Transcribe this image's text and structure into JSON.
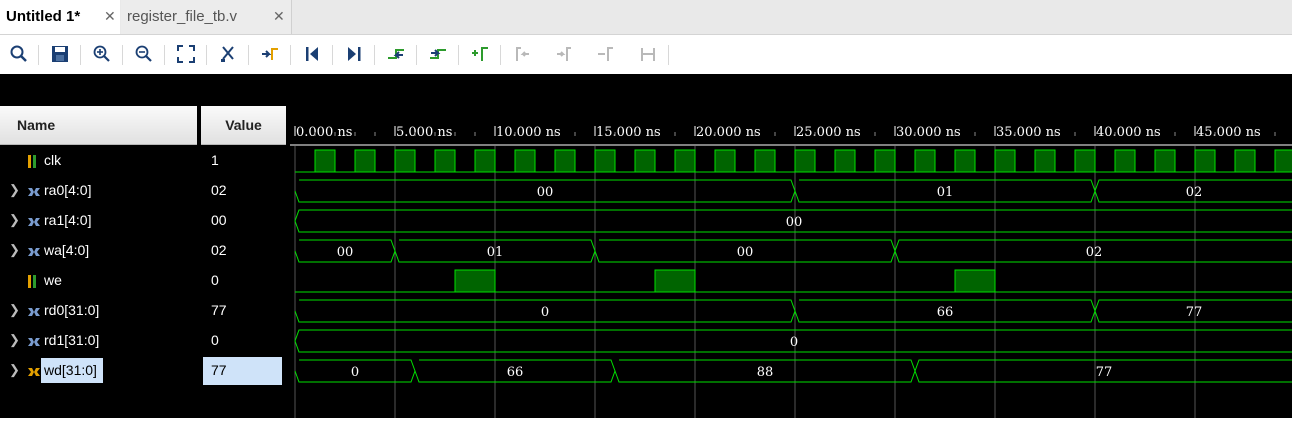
{
  "tabs": [
    {
      "label": "Untitled 1*",
      "active": true
    },
    {
      "label": "register_file_tb.v",
      "active": false
    }
  ],
  "toolbar_icons": [
    "search-icon",
    "save-icon",
    "zoom-in-icon",
    "zoom-out-icon",
    "zoom-fit-icon",
    "cursor-icon",
    "go-to-zero-icon",
    "go-to-start-icon",
    "go-to-end-icon",
    "previous-transition-icon",
    "next-transition-icon",
    "add-marker-icon",
    "previous-marker-icon",
    "next-marker-icon",
    "swap-cursors-icon",
    "cursor-range-icon"
  ],
  "headers": {
    "name": "Name",
    "value": "Value"
  },
  "signals": [
    {
      "name": "clk",
      "value": "1",
      "bus": false,
      "selected": false
    },
    {
      "name": "ra0[4:0]",
      "value": "02",
      "bus": true,
      "selected": false
    },
    {
      "name": "ra1[4:0]",
      "value": "00",
      "bus": true,
      "selected": false
    },
    {
      "name": "wa[4:0]",
      "value": "02",
      "bus": true,
      "selected": false
    },
    {
      "name": "we",
      "value": "0",
      "bus": false,
      "selected": false
    },
    {
      "name": "rd0[31:0]",
      "value": "77",
      "bus": true,
      "selected": false
    },
    {
      "name": "rd1[31:0]",
      "value": "0",
      "bus": true,
      "selected": false
    },
    {
      "name": "wd[31:0]",
      "value": "77",
      "bus": true,
      "selected": true
    }
  ],
  "time_axis": {
    "labels": [
      "0.000 ns",
      "5.000 ns",
      "10.000 ns",
      "15.000 ns",
      "20.000 ns",
      "25.000 ns",
      "30.000 ns",
      "35.000 ns",
      "40.000 ns",
      "45.000 ns"
    ],
    "major_step_ns": 5,
    "visible_range_ns": [
      0,
      49.9
    ]
  },
  "waves": {
    "clk": {
      "period_ns": 2,
      "high_first_ns": 1
    },
    "ra0[4:0]": [
      {
        "start": 0,
        "end": 25,
        "v": "00"
      },
      {
        "start": 25,
        "end": 40,
        "v": "01"
      },
      {
        "start": 40,
        "end": 49.9,
        "v": "02"
      }
    ],
    "ra1[4:0]": [
      {
        "start": 0,
        "end": 49.9,
        "v": "00"
      }
    ],
    "wa[4:0]": [
      {
        "start": 0,
        "end": 5,
        "v": "00"
      },
      {
        "start": 5,
        "end": 15,
        "v": "01"
      },
      {
        "start": 15,
        "end": 30,
        "v": "00"
      },
      {
        "start": 30,
        "end": 49.9,
        "v": "02"
      }
    ],
    "we": [
      {
        "start": 8,
        "end": 10
      },
      {
        "start": 18,
        "end": 20
      },
      {
        "start": 33,
        "end": 35
      }
    ],
    "rd0[31:0]": [
      {
        "start": 0,
        "end": 25,
        "v": "0"
      },
      {
        "start": 25,
        "end": 40,
        "v": "66"
      },
      {
        "start": 40,
        "end": 49.9,
        "v": "77"
      }
    ],
    "rd1[31:0]": [
      {
        "start": 0,
        "end": 49.9,
        "v": "0"
      }
    ],
    "wd[31:0]": [
      {
        "start": 0,
        "end": 6,
        "v": "0"
      },
      {
        "start": 6,
        "end": 16,
        "v": "66"
      },
      {
        "start": 16,
        "end": 31,
        "v": "88"
      },
      {
        "start": 31,
        "end": 49.9,
        "v": "77"
      }
    ]
  },
  "colors": {
    "wave": "#00e000",
    "wave_fill": "#006400",
    "background": "#000000",
    "grid": "#555555",
    "selection": "#cfe3f9"
  }
}
